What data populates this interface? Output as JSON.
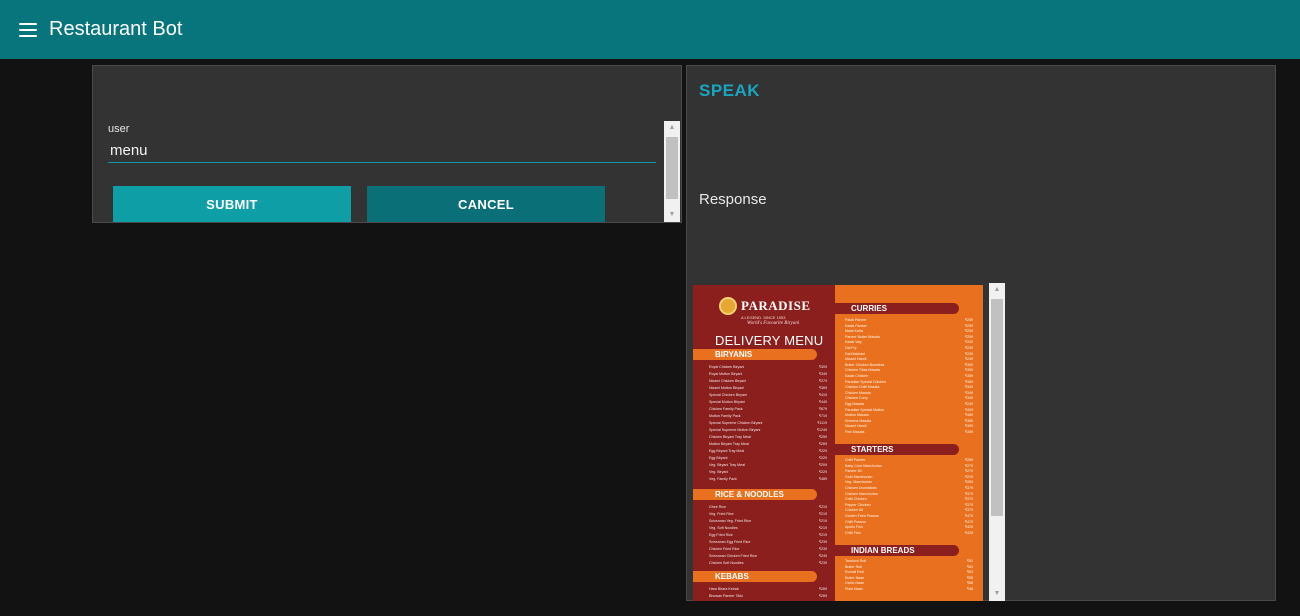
{
  "app": {
    "title": "Restaurant Bot"
  },
  "form": {
    "label": "user",
    "value": "menu",
    "submit_label": "SUBMIT",
    "cancel_label": "CANCEL"
  },
  "output": {
    "speak_label": "SPEAK",
    "response_label": "Response"
  },
  "menu_image": {
    "brand": "PARADISE",
    "tagline": "A LEGEND. SINCE 1953",
    "slogan": "World's Favourite Biryani",
    "heading": "DELIVERY MENU",
    "sections_left": [
      {
        "title": "BIRYANIS",
        "items": [
          {
            "name": "Royal Chicken Biryani",
            "price": "₹309"
          },
          {
            "name": "Royal Mutton Biryani",
            "price": "₹349"
          },
          {
            "name": "Nizami Chicken Biryani",
            "price": "₹279"
          },
          {
            "name": "Nizami Mutton Biryani",
            "price": "₹369"
          },
          {
            "name": "Special Chicken Biryani",
            "price": "₹419"
          },
          {
            "name": "Special Mutton Biryani",
            "price": "₹449"
          },
          {
            "name": "Chicken Family Pack",
            "price": "₹679"
          },
          {
            "name": "Mutton Family Pack",
            "price": "₹719"
          },
          {
            "name": "Special Supreme Chicken Biryani",
            "price": "₹1119"
          },
          {
            "name": "Special Supreme Mutton Biryani",
            "price": "₹1249"
          },
          {
            "name": "Chicken Biryani Tray Meal",
            "price": "₹259"
          },
          {
            "name": "Mutton Biryani Tray Meal",
            "price": "₹269"
          },
          {
            "name": "Egg Biryani Tray Meal",
            "price": "₹229"
          },
          {
            "name": "Egg Biryani",
            "price": "₹229"
          },
          {
            "name": "Veg. Biryani Tray Meal",
            "price": "₹209"
          },
          {
            "name": "Veg. Biryani",
            "price": "₹229"
          },
          {
            "name": "Veg. Family Pack",
            "price": "₹489"
          }
        ]
      },
      {
        "title": "RICE & NOODLES",
        "items": [
          {
            "name": "Ghee Rice",
            "price": "₹219"
          },
          {
            "name": "Veg. Fried Rice",
            "price": "₹219"
          },
          {
            "name": "Schezwan Veg. Fried Rice",
            "price": "₹219"
          },
          {
            "name": "Veg. Soft Noodles",
            "price": "₹219"
          },
          {
            "name": "Egg Fried Rice",
            "price": "₹219"
          },
          {
            "name": "Schezwan Egg Fried Rice",
            "price": "₹239"
          },
          {
            "name": "Chicken Fried Rice",
            "price": "₹239"
          },
          {
            "name": "Schezwan Chicken Fried Rice",
            "price": "₹249"
          },
          {
            "name": "Chicken Soft Noodles",
            "price": "₹239"
          }
        ]
      },
      {
        "title": "KEBABS",
        "items": [
          {
            "name": "Hara Bhara Kebab",
            "price": "₹269"
          },
          {
            "name": "Bhuwan Paneer Tikki",
            "price": "₹269"
          }
        ]
      }
    ],
    "sections_right": [
      {
        "title": "CURRIES",
        "items": [
          {
            "name": "Palak Paneer",
            "price": "₹259"
          },
          {
            "name": "Kadai Paneer",
            "price": "₹259"
          },
          {
            "name": "Malai Kofta",
            "price": "₹259"
          },
          {
            "name": "Paneer Butter Masala",
            "price": "₹259"
          },
          {
            "name": "Kadai Veg",
            "price": "₹242"
          },
          {
            "name": "Dal Fry",
            "price": "₹239"
          },
          {
            "name": "Dal Makhani",
            "price": "₹239"
          },
          {
            "name": "Nizami Handi",
            "price": "₹249"
          },
          {
            "name": "Butter Chicken Boneless",
            "price": "₹359"
          },
          {
            "name": "Chicken Tikka Masala",
            "price": "₹359"
          },
          {
            "name": "Kadai Chicken",
            "price": "₹359"
          },
          {
            "name": "Paradise Special Chicken",
            "price": "₹369"
          },
          {
            "name": "Chicken Chilli Masala",
            "price": "₹349"
          },
          {
            "name": "Chicken Masala",
            "price": "₹349"
          },
          {
            "name": "Chicken Curry",
            "price": "₹349"
          },
          {
            "name": "Egg Masala",
            "price": "₹249"
          },
          {
            "name": "Paradise Special Mutton",
            "price": "₹409"
          },
          {
            "name": "Mutton Masala",
            "price": "₹389"
          },
          {
            "name": "Kheema Masala",
            "price": "₹389"
          },
          {
            "name": "Nizami Handi",
            "price": "₹399"
          },
          {
            "name": "Fish Masala",
            "price": "₹359"
          }
        ]
      },
      {
        "title": "STARTERS",
        "items": [
          {
            "name": "Chilli Paneer",
            "price": "₹289"
          },
          {
            "name": "Baby Corn Manchurian",
            "price": "₹279"
          },
          {
            "name": "Paneer 65",
            "price": "₹279"
          },
          {
            "name": "Gobi Manchurian",
            "price": "₹219"
          },
          {
            "name": "Veg. Manchurian",
            "price": "₹269"
          },
          {
            "name": "Chicken Drumsticks",
            "price": "₹379"
          },
          {
            "name": "Chicken Manchurian",
            "price": "₹379"
          },
          {
            "name": "Chilli Chicken",
            "price": "₹379"
          },
          {
            "name": "Pepper Chicken",
            "price": "₹379"
          },
          {
            "name": "Chicken 65",
            "price": "₹379"
          },
          {
            "name": "Golden Fried Prawns",
            "price": "₹479"
          },
          {
            "name": "Chilli Prawns",
            "price": "₹479"
          },
          {
            "name": "Apollo Fish",
            "price": "₹429"
          },
          {
            "name": "Chilli Fish",
            "price": "₹429"
          }
        ]
      },
      {
        "title": "INDIAN BREADS",
        "items": [
          {
            "name": "Tandoori Roti",
            "price": "₹52"
          },
          {
            "name": "Butter Roti",
            "price": "₹63"
          },
          {
            "name": "Rumali Roti",
            "price": "₹63"
          },
          {
            "name": "Butter Naan",
            "price": "₹58"
          },
          {
            "name": "Garlic Naan",
            "price": "₹68"
          },
          {
            "name": "Plain Naan",
            "price": "₹48"
          }
        ]
      }
    ]
  }
}
